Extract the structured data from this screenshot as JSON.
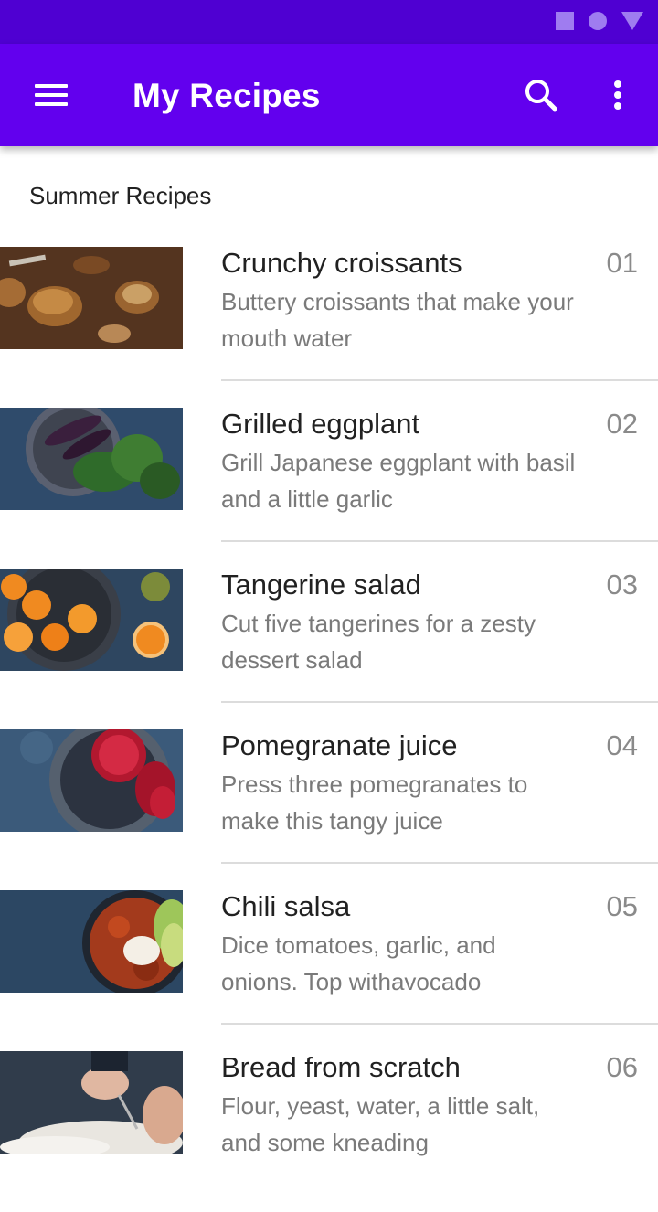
{
  "status_bar": {
    "icons": [
      "square-icon",
      "circle-icon",
      "triangle-icon"
    ],
    "color": "#4f00d2"
  },
  "app_bar": {
    "title": "My Recipes",
    "color": "#6200ee",
    "icons": [
      "menu-icon",
      "search-icon",
      "more-vert-icon"
    ]
  },
  "section": {
    "header": "Summer Recipes"
  },
  "recipes": [
    {
      "title": "Crunchy croissants",
      "description": "Buttery croissants that make your mouth water",
      "number": "01",
      "image": "croissants-image"
    },
    {
      "title": "Grilled eggplant",
      "description": "Grill Japanese eggplant with basil and a little garlic",
      "number": "02",
      "image": "eggplant-image"
    },
    {
      "title": "Tangerine salad",
      "description": "Cut five tangerines for a zesty dessert salad",
      "number": "03",
      "image": "tangerines-image"
    },
    {
      "title": "Pomegranate juice",
      "description": "Press three pomegranates to make this tangy juice",
      "number": "04",
      "image": "pomegranate-image"
    },
    {
      "title": "Chili salsa",
      "description": "Dice tomatoes, garlic, and onions. Top withavocado",
      "number": "05",
      "image": "salsa-image"
    },
    {
      "title": "Bread from scratch",
      "description": "Flour, yeast, water, a little salt, and some kneading",
      "number": "06",
      "image": "bread-image"
    }
  ]
}
